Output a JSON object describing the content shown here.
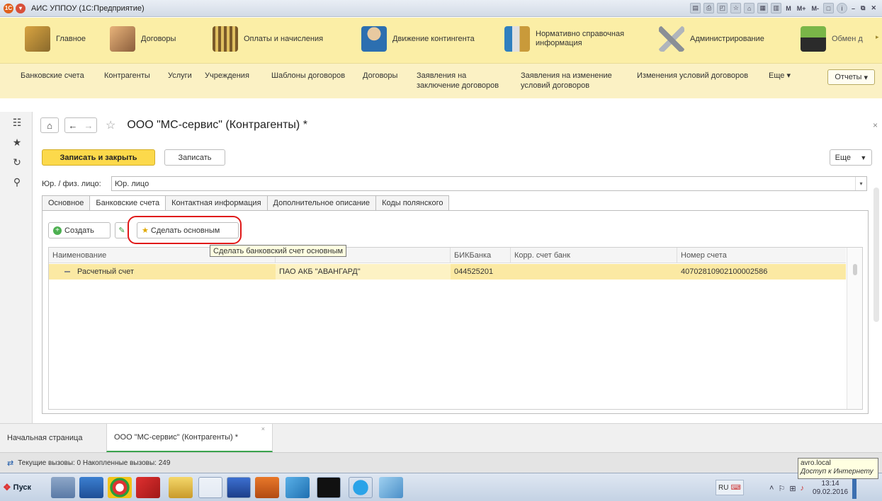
{
  "window": {
    "title": "АИС УППОУ  (1С:Предприятие)",
    "tools": [
      "M",
      "M+",
      "M-"
    ]
  },
  "sections": [
    {
      "label": "Главное",
      "icon": "home-desk-icon"
    },
    {
      "label": "Договоры",
      "icon": "handshake-icon"
    },
    {
      "label": "Оплаты и начисления",
      "icon": "abacus-icon"
    },
    {
      "label": "Движение контингента",
      "icon": "person-move-icon"
    },
    {
      "label": "Нормативно справочная информация",
      "icon": "books-icon"
    },
    {
      "label": "Администрирование",
      "icon": "tools-icon"
    },
    {
      "label": "Обмен д",
      "icon": "exchange-icon"
    }
  ],
  "subnav": {
    "items": [
      "Банковские счета",
      "Контрагенты",
      "Услуги",
      "Учреждения",
      "Шаблоны договоров",
      "Договоры",
      "Заявления на заключение договоров",
      "Заявления на изменение условий договоров",
      "Изменения условий договоров",
      "Еще"
    ],
    "reports": "Отчеты"
  },
  "form": {
    "title": "ООО \"МС-сервис\" (Контрагенты) *",
    "save_close": "Записать и закрыть",
    "save": "Записать",
    "more": "Еще",
    "type_label": "Юр. / физ. лицо:",
    "type_value": "Юр. лицо",
    "tabs": [
      "Основное",
      "Банковские счета",
      "Контактная информация",
      "Дополнительное описание",
      "Коды полянского"
    ],
    "active_tab": "Банковские счета",
    "create": "Создать",
    "make_main": "Сделать основным",
    "tooltip": "Сделать банковский счет основным",
    "columns": [
      "Наименование",
      "",
      "БИКБанка",
      "Корр. счет банк",
      "Номер счета"
    ],
    "rows": [
      {
        "name": "Расчетный счет",
        "bank": "ПАО АКБ \"АВАНГАРД\"",
        "bik": "044525201",
        "corr": "",
        "account": "40702810902100002586"
      }
    ]
  },
  "open_windows": [
    "Начальная страница",
    "ООО \"МС-сервис\" (Контрагенты) *"
  ],
  "status": {
    "calls": "Текущие вызовы: 0   Накопленные вызовы: 249",
    "net_title": "avro.local",
    "net_sub": "Доступ к Интернету"
  },
  "taskbar": {
    "start": "Пуск",
    "lang": "RU",
    "time": "13:14",
    "date": "09.02.2016"
  }
}
